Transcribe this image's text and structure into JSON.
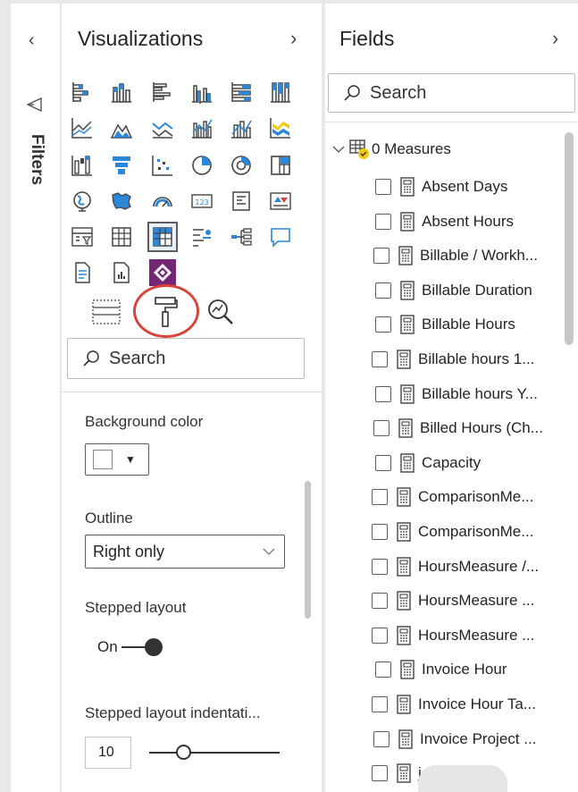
{
  "filters": {
    "label": "Filters"
  },
  "visualizations": {
    "title": "Visualizations",
    "search_placeholder": "Search",
    "background_color_label": "Background color",
    "outline_label": "Outline",
    "outline_value": "Right only",
    "stepped_layout_label": "Stepped layout",
    "stepped_toggle_value": "On",
    "indentation_label": "Stepped layout indentati...",
    "indentation_value": "10",
    "icons": [
      "stacked-bar-chart-icon",
      "stacked-column-chart-icon",
      "clustered-bar-chart-icon",
      "clustered-column-chart-icon",
      "100-stacked-bar-chart-icon",
      "100-stacked-column-chart-icon",
      "line-chart-icon",
      "area-chart-icon",
      "stacked-area-chart-icon",
      "line-clustered-column-icon",
      "line-stacked-column-icon",
      "ribbon-chart-icon",
      "waterfall-chart-icon",
      "funnel-chart-icon",
      "scatter-chart-icon",
      "pie-chart-icon",
      "donut-chart-icon",
      "treemap-icon",
      "map-icon",
      "filled-map-icon",
      "gauge-icon",
      "card-icon",
      "multi-row-card-icon",
      "kpi-icon",
      "slicer-icon",
      "table-icon",
      "matrix-icon",
      "key-influencers-icon",
      "decomposition-tree-icon",
      "qa-icon",
      "smart-narrative-icon",
      "paginated-report-icon",
      "power-apps-icon"
    ]
  },
  "fields": {
    "title": "Fields",
    "search_placeholder": "Search",
    "root_label": "0 Measures",
    "items": [
      "Absent Days",
      "Absent Hours",
      "Billable / Workh...",
      "Billable Duration",
      "Billable Hours",
      "Billable hours 1...",
      "Billable hours Y...",
      "Billed Hours (Ch...",
      "Capacity",
      "ComparisonMe...",
      "ComparisonMe...",
      "HoursMeasure /...",
      "HoursMeasure ...",
      "HoursMeasure ...",
      "Invoice Hour",
      "Invoice Hour Ta...",
      "Invoice Project ...",
      "ject ..."
    ]
  }
}
